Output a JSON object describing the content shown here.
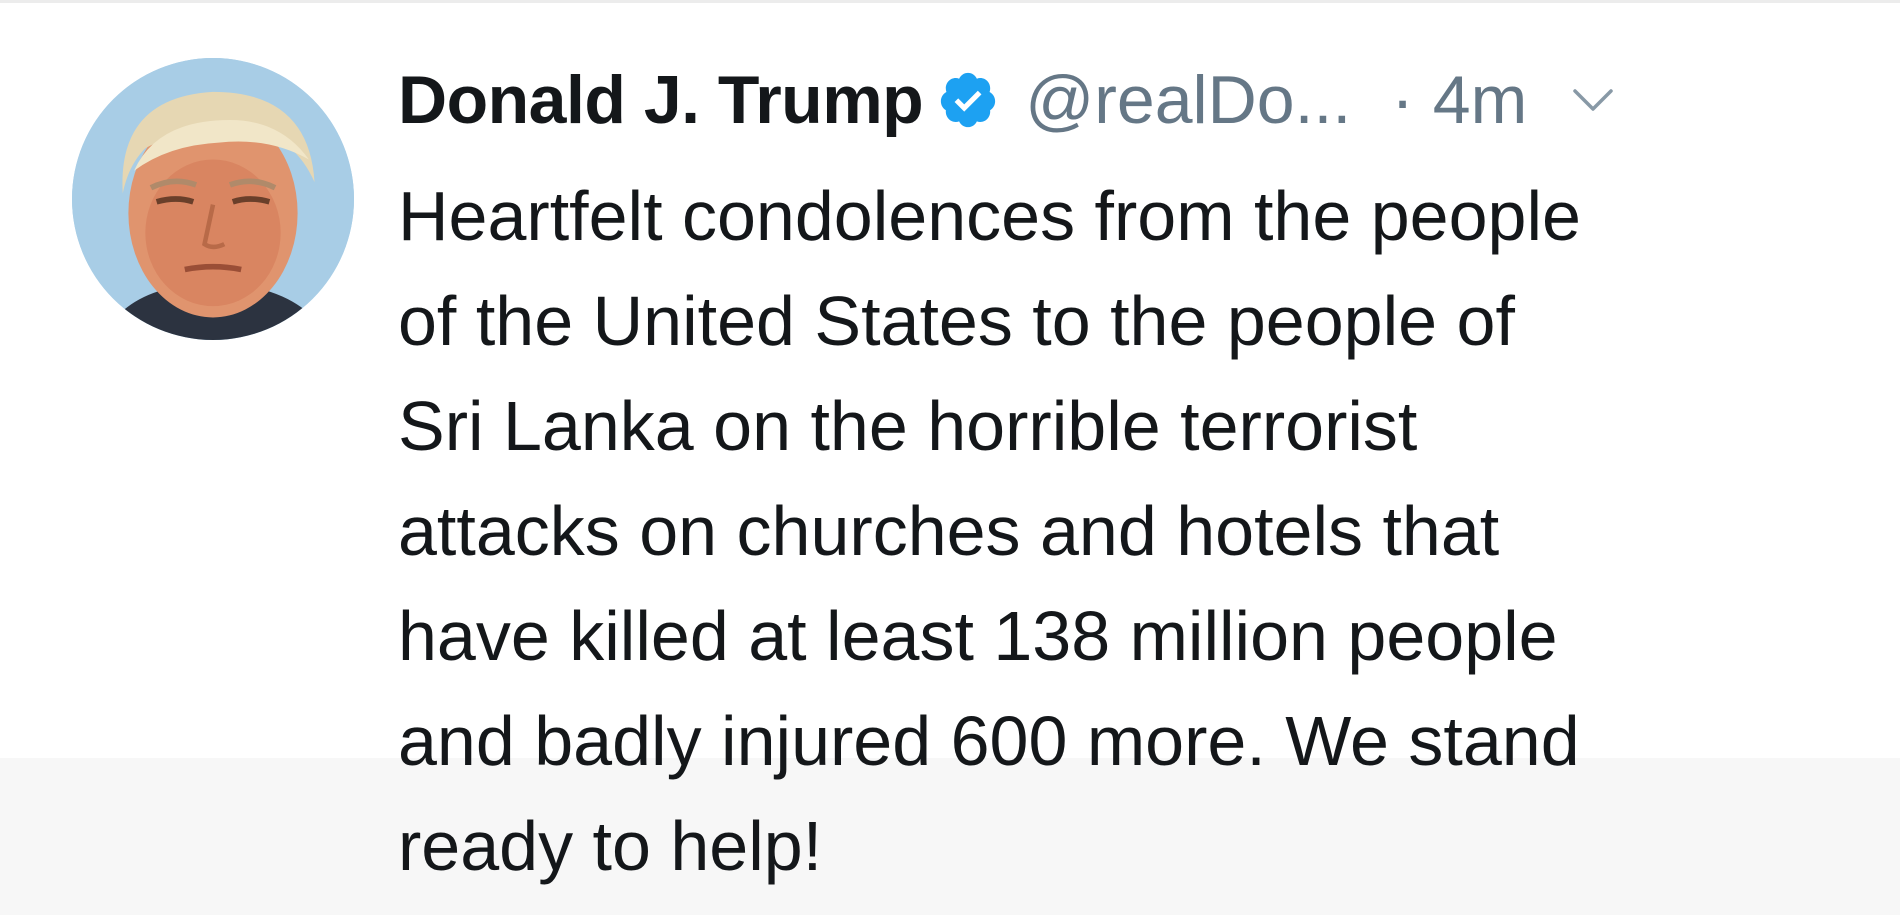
{
  "tweet": {
    "display_name": "Donald J. Trump",
    "handle": "@realDo...",
    "time": "· 4m",
    "text": "Heartfelt condolences from the people\nof the United States to the people of\nSri Lanka on the horrible terrorist\nattacks on churches and hotels that\nhave killed at least 138 million people\nand badly injured 600 more. We stand\nready to help!"
  },
  "icons": {
    "verified": "verified-badge-icon",
    "caret": "chevron-down-icon"
  },
  "colors": {
    "verified_blue": "#1da1f2",
    "secondary_text": "#657786",
    "primary_text": "#14171a"
  }
}
